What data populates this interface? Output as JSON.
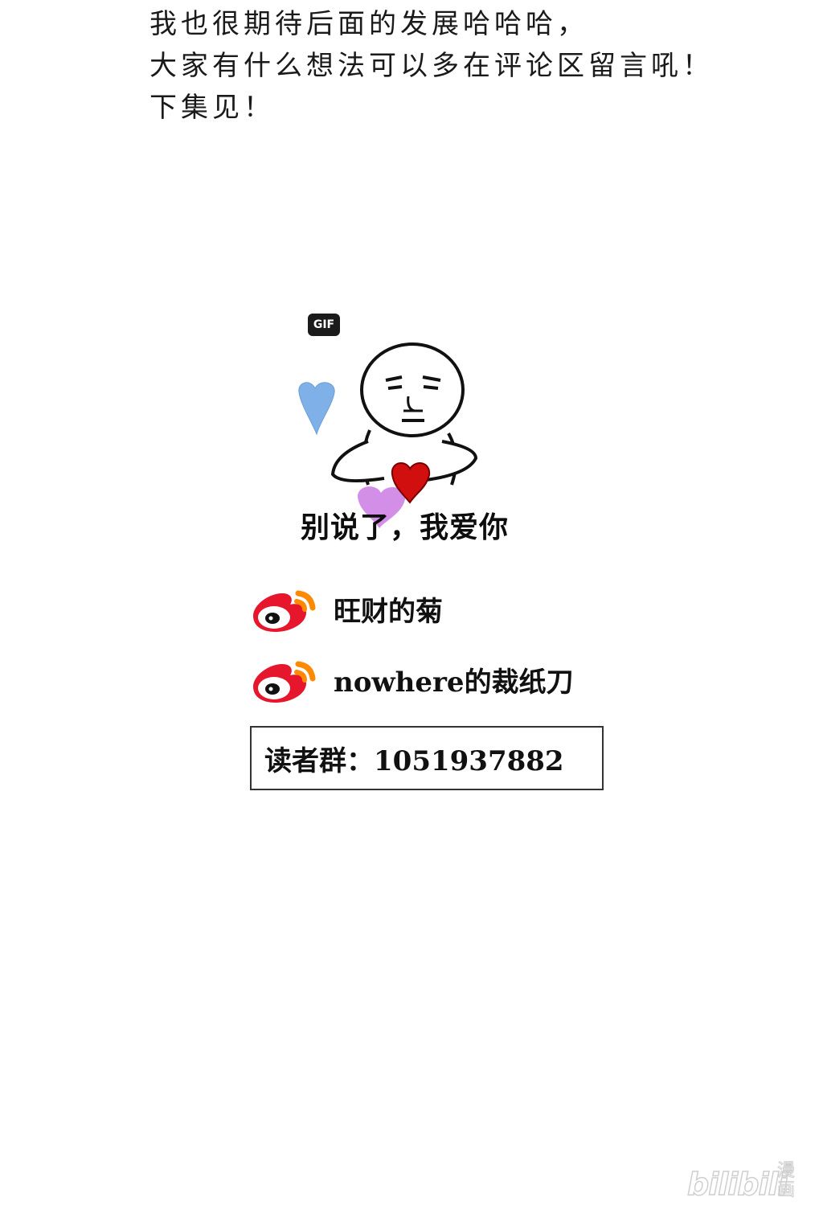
{
  "note": {
    "lines": [
      "我也很期待后面的发展哈哈哈，",
      "大家有什么想法可以多在评论区留言吼！",
      "下集见！"
    ]
  },
  "gif": {
    "badge": "GIF",
    "caption": "别说了，我爱你"
  },
  "social": {
    "accounts": [
      {
        "icon": "weibo-icon",
        "handle": "旺财的菊"
      },
      {
        "icon": "weibo-icon",
        "handle": "nowhere的裁纸刀"
      }
    ]
  },
  "reader_group": {
    "text": "读者群：1051937882"
  },
  "watermark": {
    "latin": "bilibili",
    "cn": "漫画"
  },
  "colors": {
    "weibo_red": "#e6162d",
    "weibo_orange": "#ff8a00",
    "heart_blue": "#7fb1e8",
    "heart_red": "#d10f0f",
    "heart_purple": "#d38ee8"
  }
}
